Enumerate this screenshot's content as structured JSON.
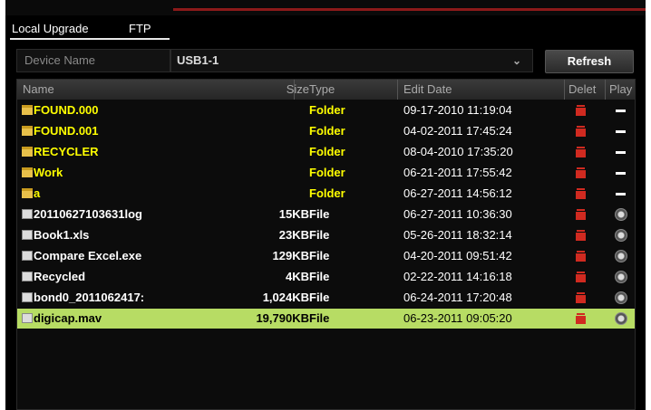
{
  "tabs": [
    {
      "label": "Local Upgrade"
    },
    {
      "label": "FTP"
    }
  ],
  "device": {
    "label": "Device Name",
    "selected": "USB1-1",
    "chevron": "⌄"
  },
  "refresh_label": "Refresh",
  "columns": {
    "name": "Name",
    "size": "Size",
    "type": "Type",
    "date": "Edit Date",
    "delete": "Delet",
    "play": "Play"
  },
  "colors": {
    "folder_text": "#ffff00",
    "file_text": "#ffffff",
    "selected_row": "#b7dc64",
    "accent": "#8c1a1a",
    "delete_icon": "#d02a20"
  },
  "files": [
    {
      "name": "FOUND.000",
      "size": "",
      "type": "Folder",
      "date": "09-17-2010 11:19:04",
      "kind": "folder",
      "icon": "folder-icon",
      "play": "dash"
    },
    {
      "name": "FOUND.001",
      "size": "",
      "type": "Folder",
      "date": "04-02-2011 17:45:24",
      "kind": "folder",
      "icon": "folder-icon",
      "play": "dash"
    },
    {
      "name": "RECYCLER",
      "size": "",
      "type": "Folder",
      "date": "08-04-2010 17:35:20",
      "kind": "folder",
      "icon": "folder-icon",
      "play": "dash"
    },
    {
      "name": "Work",
      "size": "",
      "type": "Folder",
      "date": "06-21-2011 17:55:42",
      "kind": "folder",
      "icon": "folder-icon",
      "play": "dash"
    },
    {
      "name": "a",
      "size": "",
      "type": "Folder",
      "date": "06-27-2011 14:56:12",
      "kind": "folder",
      "icon": "folder-icon",
      "play": "dash"
    },
    {
      "name": "20110627103631log",
      "size": "15KB",
      "type": "File",
      "date": "06-27-2011 10:36:30",
      "kind": "file",
      "icon": "file-icon",
      "play": "circle"
    },
    {
      "name": "Book1.xls",
      "size": "23KB",
      "type": "File",
      "date": "05-26-2011 18:32:14",
      "kind": "file",
      "icon": "file-icon",
      "play": "circle"
    },
    {
      "name": "Compare Excel.exe",
      "size": "129KB",
      "type": "File",
      "date": "04-20-2011 09:51:42",
      "kind": "file",
      "icon": "file-icon",
      "play": "circle"
    },
    {
      "name": "Recycled",
      "size": "4KB",
      "type": "File",
      "date": "02-22-2011 14:16:18",
      "kind": "file",
      "icon": "file-icon",
      "play": "circle"
    },
    {
      "name": "bond0_2011062417:",
      "size": "1,024KB",
      "type": "File",
      "date": "06-24-2011 17:20:48",
      "kind": "file",
      "icon": "file-icon",
      "play": "circle"
    },
    {
      "name": "digicap.mav",
      "size": "19,790KB",
      "type": "File",
      "date": "06-23-2011 09:05:20",
      "kind": "file",
      "icon": "file-icon",
      "play": "circle",
      "selected": true
    }
  ]
}
